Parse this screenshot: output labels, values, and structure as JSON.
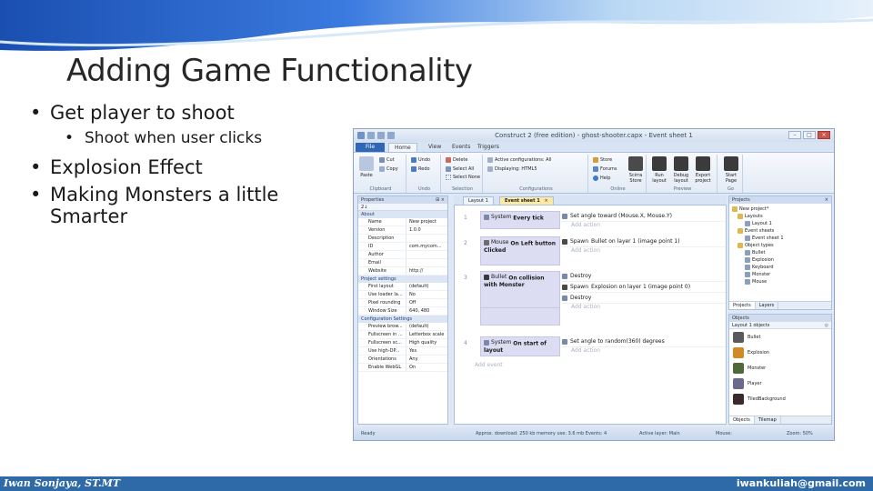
{
  "slide": {
    "title": "Adding Game Functionality",
    "bullets": [
      {
        "text": "Get player to shoot",
        "sub": [
          "Shoot when user clicks"
        ]
      },
      {
        "text": "Explosion Effect",
        "sub": []
      },
      {
        "text": "Making Monsters a little Smarter",
        "sub": []
      }
    ],
    "footer_left": "Iwan Sonjaya, ST.MT",
    "footer_right": "iwankuliah@gmail.com",
    "colors": {
      "accent": "#2e6aa8",
      "wave": "#1c56b4"
    }
  },
  "app": {
    "title": "Construct 2 (free edition) - ghost-shooter.capx - Event sheet 1",
    "tabs": [
      "File",
      "Home",
      "View",
      "Events",
      "Triggers"
    ],
    "ribbon": {
      "clipboard": {
        "label": "Clipboard",
        "paste": "Paste",
        "cut": "Cut",
        "copy": "Copy"
      },
      "undo": {
        "label": "Undo",
        "undo": "Undo",
        "redo": "Redo"
      },
      "selection": {
        "label": "Selection",
        "delete": "Delete",
        "select_all": "Select All",
        "select_none": "Select None"
      },
      "configurations": {
        "label": "Configurations",
        "active": "Active configurations: All",
        "displaying": "Displaying: HTML5"
      },
      "online": {
        "label": "Online",
        "store": "Store",
        "forums": "Forums",
        "help": "Help",
        "scirra_store": "Scirra Store"
      },
      "preview": {
        "label": "Preview",
        "run": "Run layout",
        "debug": "Debug layout",
        "export": "Export project"
      },
      "go": {
        "label": "Go",
        "start": "Start Page"
      }
    },
    "properties": {
      "header": "Properties",
      "toolbar": "2↓",
      "sections": [
        {
          "name": "About",
          "rows": [
            [
              "Name",
              "New project"
            ],
            [
              "Version",
              "1.0.0"
            ],
            [
              "Description",
              ""
            ],
            [
              "ID",
              "com.mycom..."
            ],
            [
              "Author",
              ""
            ],
            [
              "Email",
              ""
            ],
            [
              "Website",
              "http://"
            ]
          ]
        },
        {
          "name": "Project settings",
          "rows": [
            [
              "First layout",
              "(default)"
            ],
            [
              "Use loader la...",
              "No"
            ],
            [
              "Pixel rounding",
              "Off"
            ],
            [
              "Window Size",
              "640, 480"
            ]
          ]
        },
        {
          "name": "Configuration Settings",
          "rows": [
            [
              "Preview brow...",
              "(default)"
            ],
            [
              "Fullscreen in ...",
              "Letterbox scale"
            ],
            [
              "Fullscreen sc...",
              "High quality"
            ],
            [
              "Use high-DP...",
              "Yes"
            ],
            [
              "Orientations",
              "Any"
            ],
            [
              "Enable WebGL",
              "On"
            ]
          ]
        }
      ]
    },
    "doc_tabs": {
      "layout": "Layout 1",
      "sheet": "Event sheet 1"
    },
    "events": [
      {
        "num": "1",
        "object": "System",
        "condition": "Every tick",
        "actions": [
          {
            "object": "",
            "text": "Set angle toward (Mouse.X, Mouse.Y)"
          }
        ]
      },
      {
        "num": "2",
        "object": "Mouse",
        "condition": "On Left button Clicked",
        "actions": [
          {
            "object": "Spawn",
            "text": "Bullet on layer 1 (image point 1)"
          }
        ]
      },
      {
        "num": "3",
        "object": "Bullet",
        "condition": "On collision with Monster",
        "actions": [
          {
            "object": "",
            "text": "Destroy"
          },
          {
            "object": "Spawn",
            "text": "Explosion on layer 1 (image point 0)"
          },
          {
            "object": "",
            "text": "Destroy"
          }
        ]
      },
      {
        "num": "4",
        "object": "System",
        "condition": "On start of layout",
        "actions": [
          {
            "object": "",
            "text": "Set angle to random(360) degrees"
          }
        ]
      }
    ],
    "add_action": "Add action",
    "add_event": "Add event",
    "projects": {
      "header": "Projects",
      "tree": [
        "New project*",
        "Layouts",
        "Layout 1",
        "Event sheets",
        "Event sheet 1",
        "Object types",
        "Bullet",
        "Explosion",
        "Keyboard",
        "Monster",
        "Mouse"
      ],
      "tabs": [
        "Projects",
        "Layers"
      ]
    },
    "objects_panel": {
      "header": "Objects",
      "subheader": "Layout 1 objects",
      "items": [
        "Bullet",
        "Explosion",
        "Monster",
        "Player",
        "TiledBackground"
      ],
      "tabs": [
        "Objects",
        "Tilemap"
      ]
    },
    "status": {
      "ready": "Ready",
      "download": "Approx. download: 250 kb  memory use: 3.6 mb  Events: 4",
      "layer": "Active layer: Main",
      "mouse": "Mouse:",
      "zoom": "Zoom: 50%"
    }
  }
}
